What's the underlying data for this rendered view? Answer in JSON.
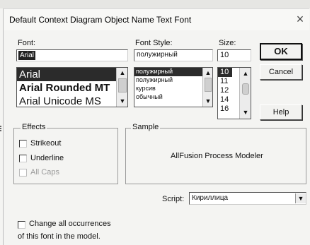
{
  "dialog": {
    "title": "Default Context Diagram Object Name Text Font",
    "close_glyph": "×"
  },
  "font": {
    "label": "Font:",
    "value": "Arial",
    "items": [
      "Arial",
      "Arial Rounded MT",
      "Arial Unicode MS"
    ],
    "selected_index": 0
  },
  "style": {
    "label": "Font Style:",
    "value": "полужирный",
    "items": [
      "полужирный",
      "полужирный",
      "курсив",
      "обычный"
    ],
    "selected_index": 0
  },
  "size": {
    "label": "Size:",
    "value": "10",
    "items": [
      "10",
      "11",
      "12",
      "14",
      "16"
    ],
    "selected_index": 0
  },
  "buttons": {
    "ok": "OK",
    "cancel": "Cancel",
    "help": "Help"
  },
  "effects": {
    "label": "Effects",
    "strikeout": "Strikeout",
    "underline": "Underline",
    "all_caps": "All Caps"
  },
  "sample": {
    "label": "Sample",
    "text": "AllFusion Process Modeler"
  },
  "script": {
    "label": "Script:",
    "value": "Кириллица"
  },
  "change_all": {
    "line1": "Change all occurrences",
    "line2": "of this font in the model."
  },
  "icons": {
    "up": "▲",
    "down": "▼",
    "close": "close-icon"
  }
}
